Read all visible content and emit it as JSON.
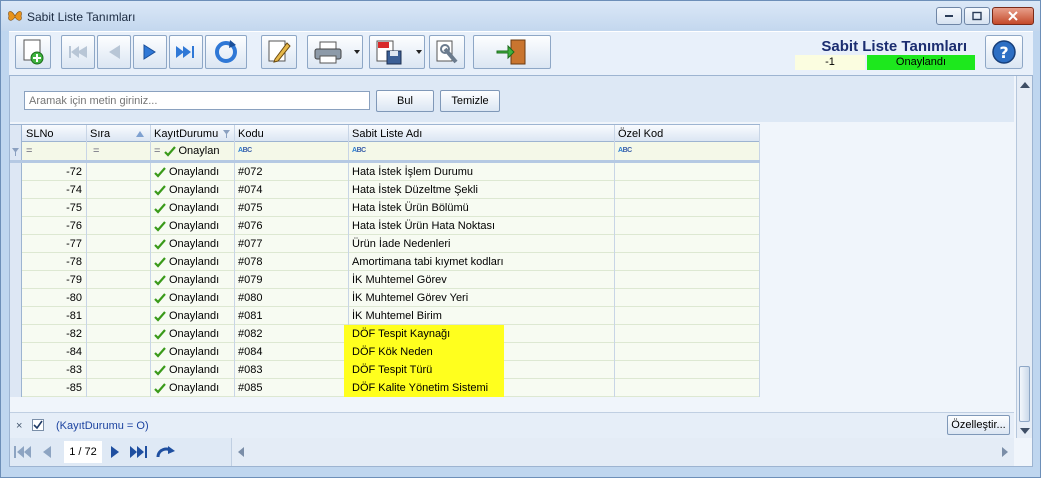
{
  "window": {
    "title": "Sabit Liste Tanımları"
  },
  "header": {
    "title": "Sabit Liste Tanımları",
    "record_id": "-1",
    "status": "Onaylandı"
  },
  "search": {
    "placeholder": "Aramak için metin giriniz...",
    "find_label": "Bul",
    "clear_label": "Temizle"
  },
  "columns": [
    "SLNo",
    "Sıra",
    "KayıtDurumu",
    "Kodu",
    "Sabit Liste Adı",
    "Özel Kod"
  ],
  "filter_row": {
    "slno": "=",
    "sira": "=",
    "durum_op": "=",
    "durum": "Onaylan",
    "kod_type": "abc",
    "ad_type": "abc",
    "ozel_type": "abc"
  },
  "rows": [
    {
      "slno": "-72",
      "durum": "Onaylandı",
      "kod": "#072",
      "ad": "Hata İstek İşlem Durumu",
      "highlight": false
    },
    {
      "slno": "-74",
      "durum": "Onaylandı",
      "kod": "#074",
      "ad": "Hata İstek Düzeltme Şekli",
      "highlight": false
    },
    {
      "slno": "-75",
      "durum": "Onaylandı",
      "kod": "#075",
      "ad": "Hata İstek Ürün Bölümü",
      "highlight": false
    },
    {
      "slno": "-76",
      "durum": "Onaylandı",
      "kod": "#076",
      "ad": "Hata İstek Ürün Hata Noktası",
      "highlight": false
    },
    {
      "slno": "-77",
      "durum": "Onaylandı",
      "kod": "#077",
      "ad": "Ürün İade Nedenleri",
      "highlight": false
    },
    {
      "slno": "-78",
      "durum": "Onaylandı",
      "kod": "#078",
      "ad": "Amortimana tabi kıymet kodları",
      "highlight": false
    },
    {
      "slno": "-79",
      "durum": "Onaylandı",
      "kod": "#079",
      "ad": "İK Muhtemel Görev",
      "highlight": false
    },
    {
      "slno": "-80",
      "durum": "Onaylandı",
      "kod": "#080",
      "ad": "İK Muhtemel Görev Yeri",
      "highlight": false
    },
    {
      "slno": "-81",
      "durum": "Onaylandı",
      "kod": "#081",
      "ad": "İK Muhtemel Birim",
      "highlight": false
    },
    {
      "slno": "-82",
      "durum": "Onaylandı",
      "kod": "#082",
      "ad": "DÖF Tespit Kaynağı",
      "highlight": true
    },
    {
      "slno": "-84",
      "durum": "Onaylandı",
      "kod": "#084",
      "ad": "DÖF Kök Neden",
      "highlight": true
    },
    {
      "slno": "-83",
      "durum": "Onaylandı",
      "kod": "#083",
      "ad": "DÖF Tespit Türü",
      "highlight": true
    },
    {
      "slno": "-85",
      "durum": "Onaylandı",
      "kod": "#085",
      "ad": "DÖF Kalite Yönetim Sistemi",
      "highlight": true
    }
  ],
  "filter_bar": {
    "close": "×",
    "expression": "(KayıtDurumu = O)",
    "customize_label": "Özelleştir..."
  },
  "navigator": {
    "page": "1 / 72"
  },
  "colors": {
    "status_green": "#1de81d",
    "highlight": "#ffff1e",
    "header_blue": "#1b2d70"
  },
  "icons": [
    "butterfly-icon",
    "new-record-icon",
    "first-icon",
    "prev-icon",
    "next-icon",
    "last-icon",
    "refresh-icon",
    "edit-icon",
    "print-icon",
    "pdf-save-icon",
    "tools-icon",
    "exit-icon",
    "help-icon"
  ]
}
